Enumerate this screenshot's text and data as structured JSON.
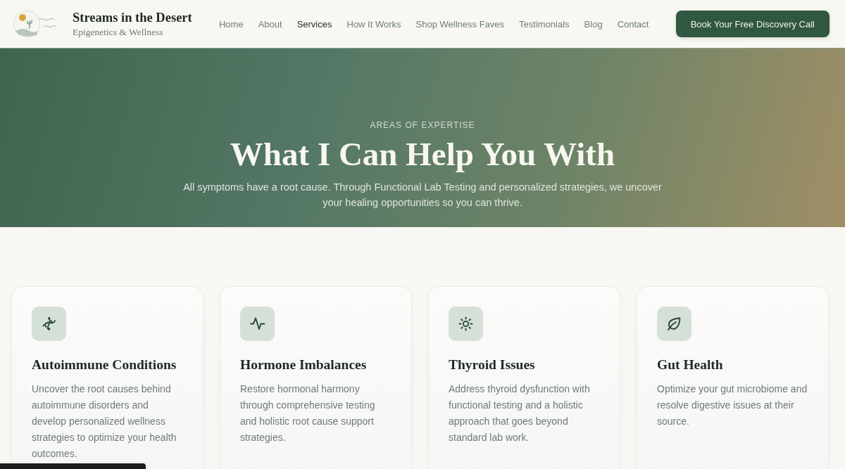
{
  "header": {
    "brand": {
      "title": "Streams in the Desert",
      "subtitle": "Epigenetics & Wellness"
    },
    "nav": [
      {
        "label": "Home",
        "selected": false
      },
      {
        "label": "About",
        "selected": false
      },
      {
        "label": "Services",
        "selected": true
      },
      {
        "label": "How It Works",
        "selected": false
      },
      {
        "label": "Shop Wellness Faves",
        "selected": false
      },
      {
        "label": "Testimonials",
        "selected": false
      },
      {
        "label": "Blog",
        "selected": false
      },
      {
        "label": "Contact",
        "selected": false
      }
    ],
    "cta_button": "Book Your Free Discovery Call"
  },
  "hero": {
    "eyebrow": "AREAS OF EXPERTISE",
    "title": "What I Can Help You With",
    "subtitle": "All symptoms have a root cause. Through Functional Lab Testing and personalized strategies, we uncover your healing opportunities so you can thrive."
  },
  "services": [
    {
      "title": "Autoimmune Conditions",
      "description": "Uncover the root causes behind autoimmune disorders and develop personalized wellness strategies to optimize your health outcomes."
    },
    {
      "title": "Hormone Imbalances",
      "description": "Restore hormonal harmony through comprehensive testing and holistic root cause support strategies."
    },
    {
      "title": "Thyroid Issues",
      "description": "Address thyroid dysfunction with functional testing and a holistic approach that goes beyond standard lab work."
    },
    {
      "title": "Gut Health",
      "description": "Optimize your gut microbiome and resolve digestive issues at their source."
    }
  ]
}
